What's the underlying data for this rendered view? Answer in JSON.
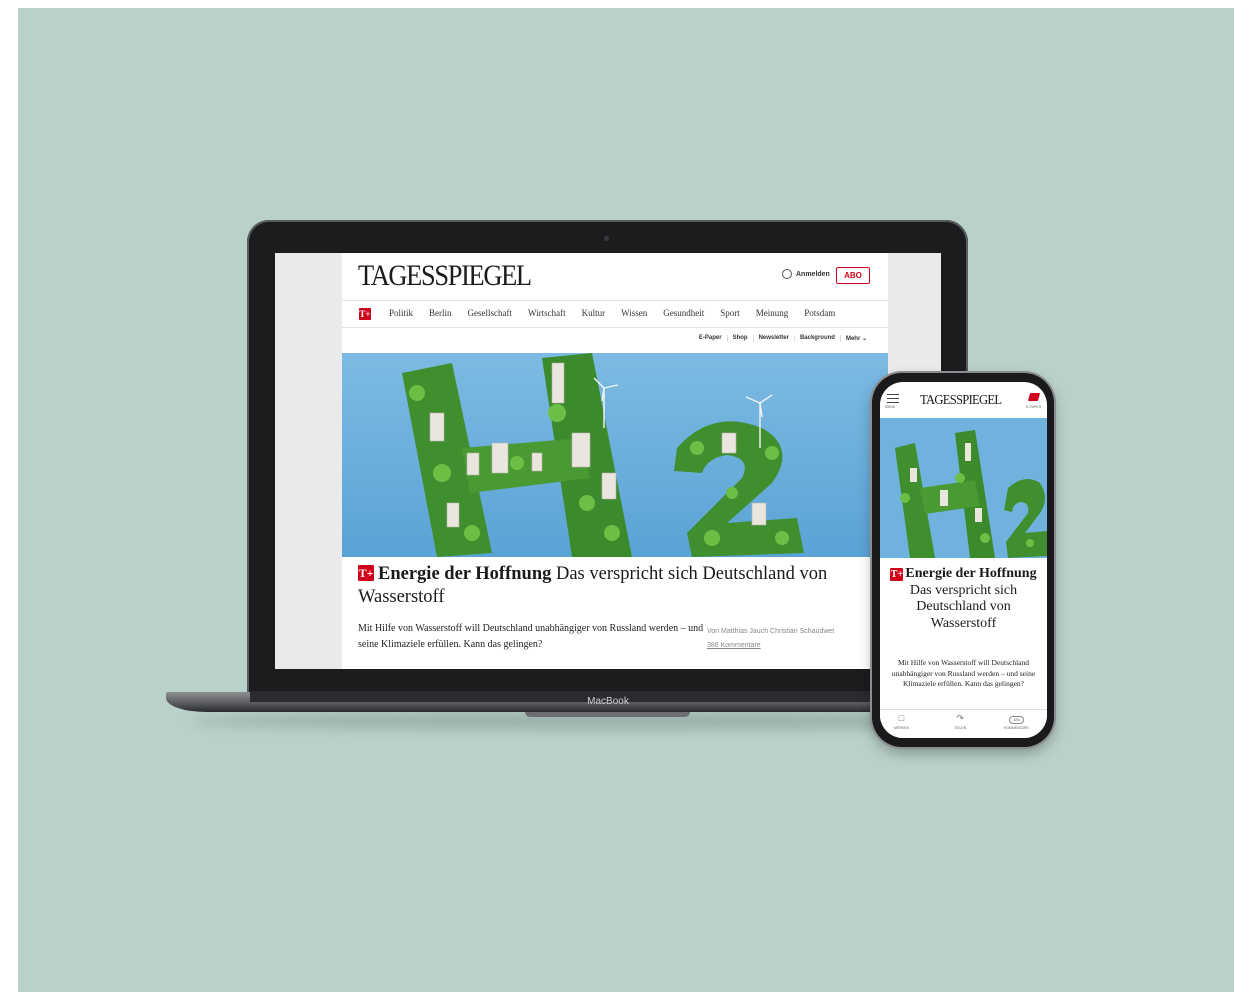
{
  "laptop": {
    "site": {
      "logo": "TAGESSPIEGEL",
      "login_label": "Anmelden",
      "abo_label": "ABO",
      "tplus_label": "T+",
      "nav": [
        "Politik",
        "Berlin",
        "Gesellschaft",
        "Wirtschaft",
        "Kultur",
        "Wissen",
        "Gesundheit",
        "Sport",
        "Meinung",
        "Potsdam"
      ],
      "subnav": [
        "E-Paper",
        "Shop",
        "Newsletter",
        "Background",
        "Mehr ⌄"
      ],
      "hero_alt_text": "H2",
      "headline_kicker": "Energie der Hoffnung",
      "headline_title": "Das verspricht sich Deutschland von Wasserstoff",
      "teaser": "Mit Hilfe von Wasserstoff will Deutschland unabhängiger von Russland werden – und seine Klimaziele erfüllen. Kann das gelingen?",
      "byline": "Von Matthias Jauch Christian Schaudwet",
      "comments": "386 Kommentare"
    },
    "brand_label": "MacBook"
  },
  "phone": {
    "menu_label": "MENÜ",
    "logo": "TAGESSPIEGEL",
    "epaper_label": "E-PAPER",
    "headline_kicker": "Energie der Hoffnung",
    "headline_title": "Das verspricht sich Deutschland von Wasserstoff",
    "teaser": "Mit Hilfe von Wasserstoff will Deutschland unabhängiger von Russland werden – und seine Klimaziele erfüllen. Kann das gelingen?",
    "tabs": [
      {
        "label": "MERKEN",
        "icon": "bookmark-icon"
      },
      {
        "label": "TEILEN",
        "icon": "share-icon"
      },
      {
        "label": "KOMMENTARE",
        "icon": "comment-icon",
        "count": "386"
      }
    ]
  },
  "colors": {
    "background": "#bad1c9",
    "accent": "#d0021b",
    "sky": "#6fb2dd"
  }
}
